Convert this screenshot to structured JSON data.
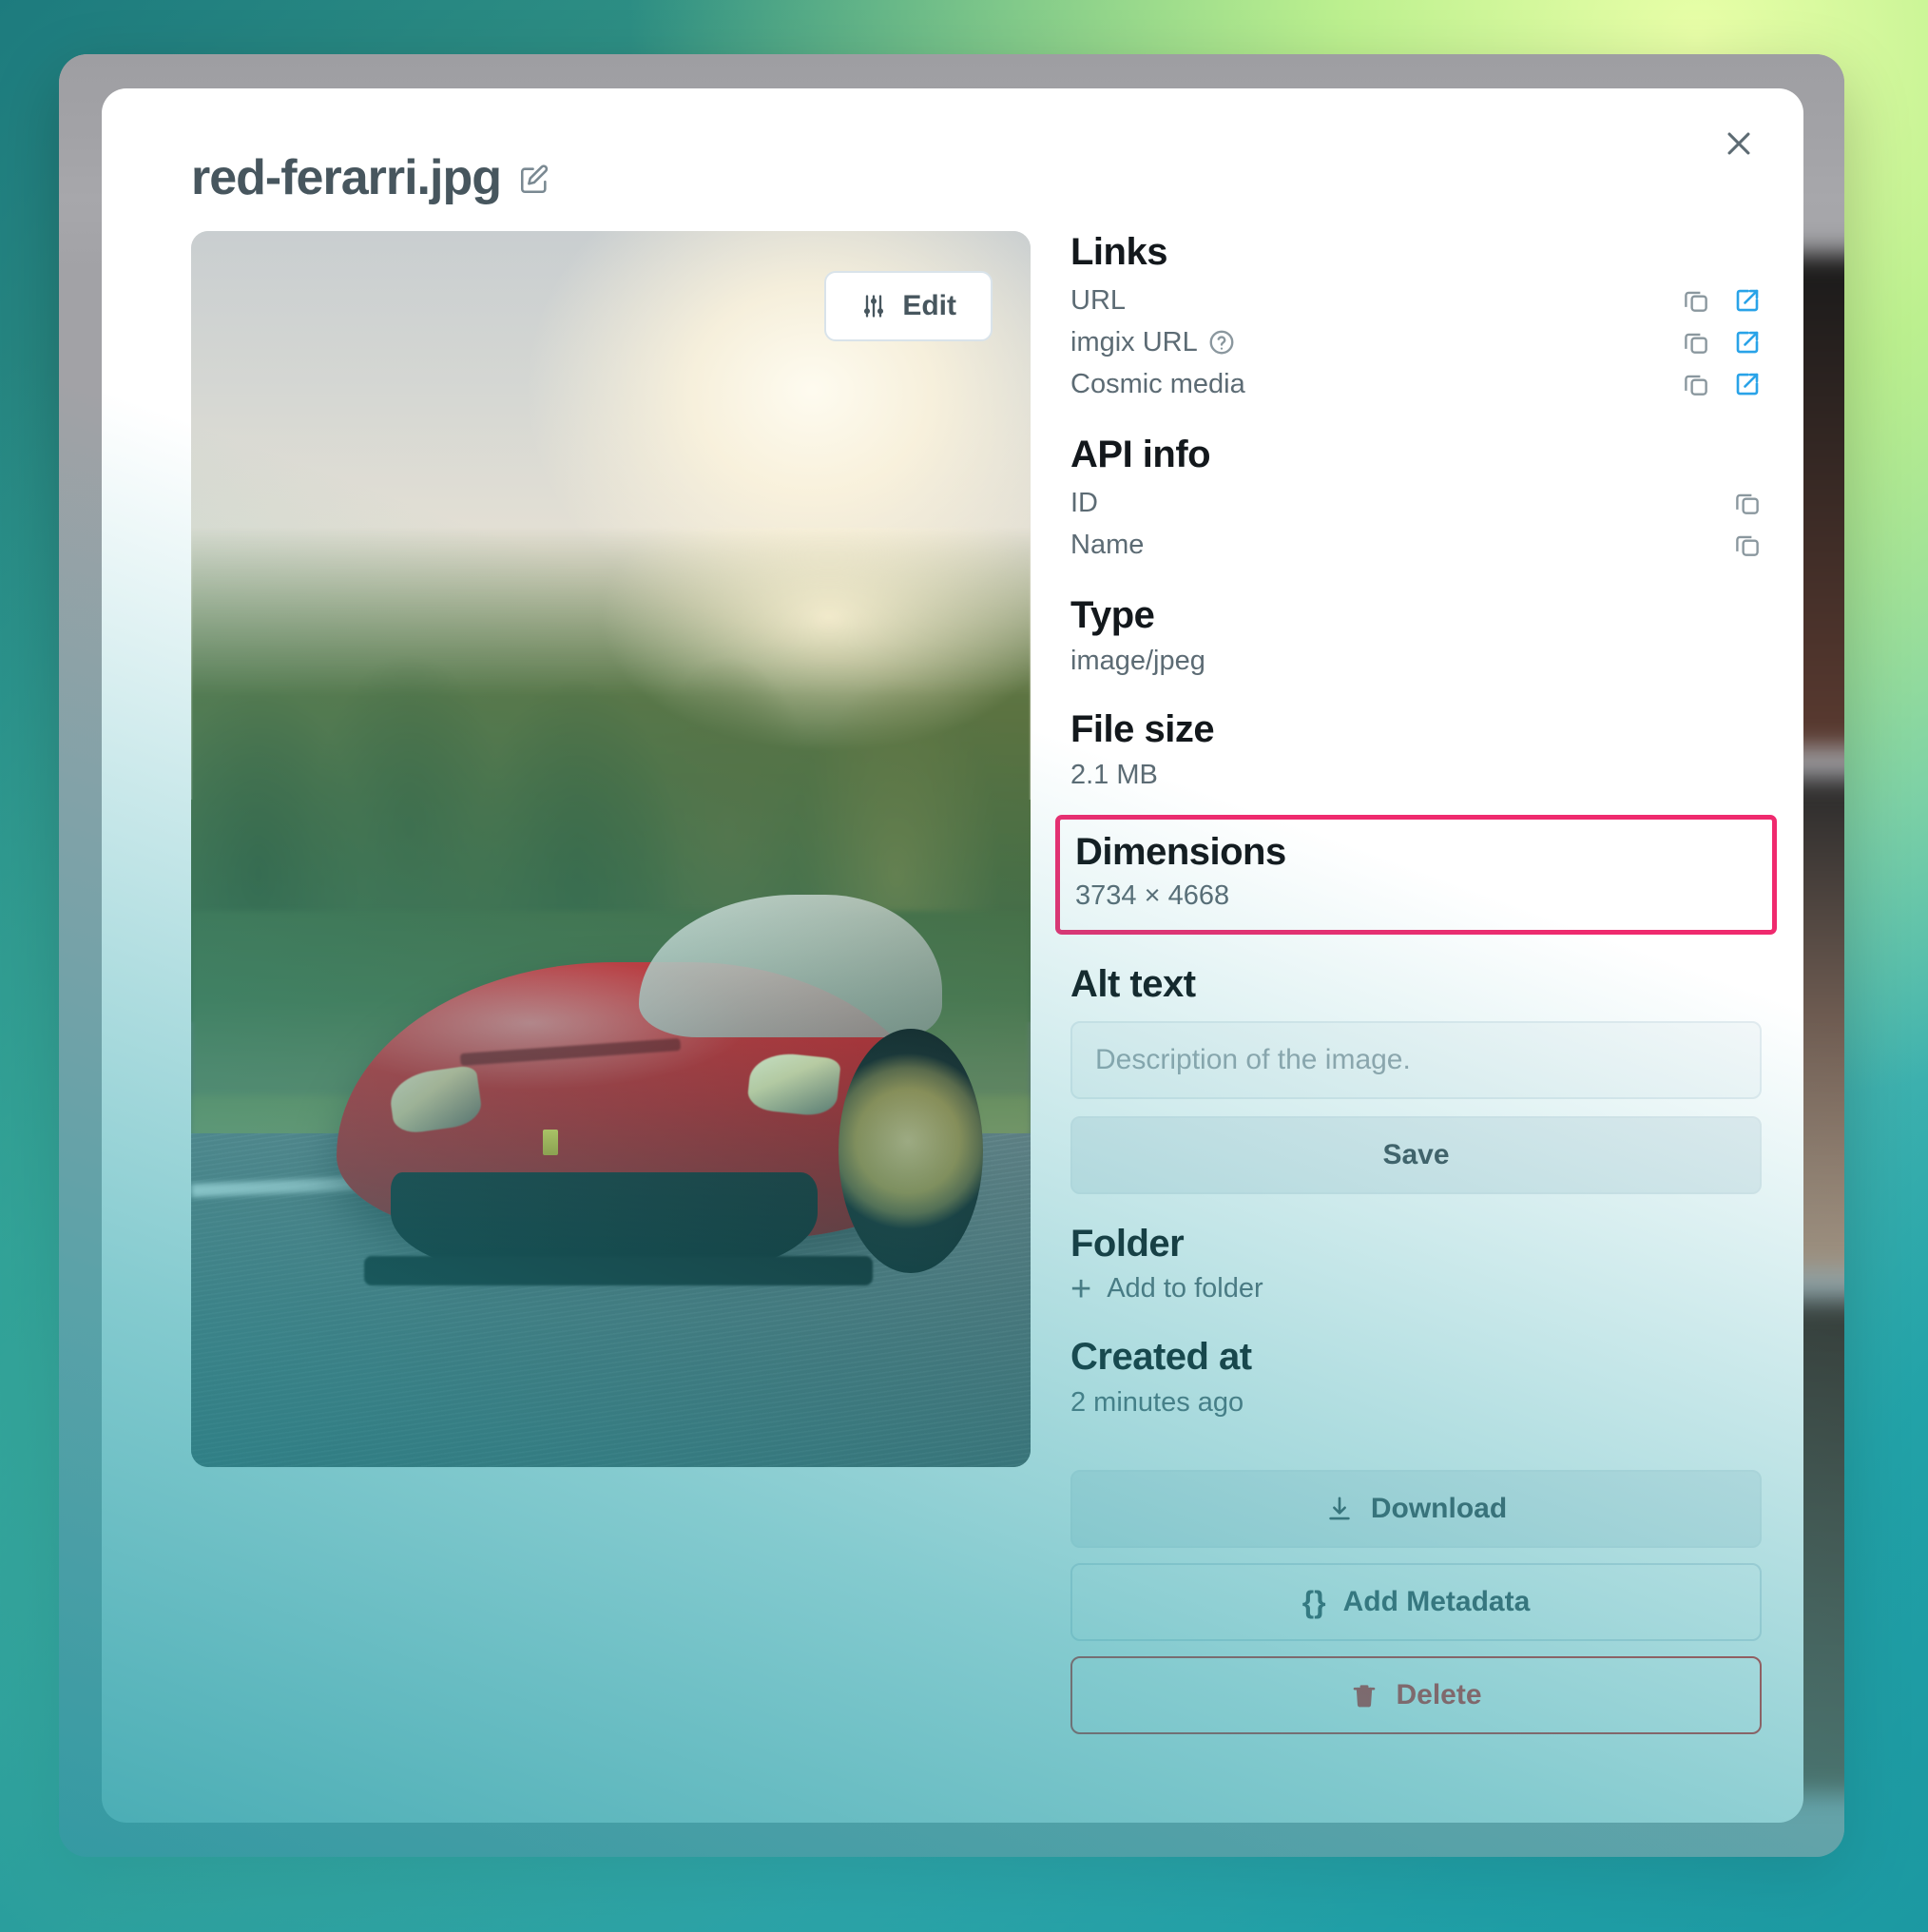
{
  "theme": {
    "accent_blue": "#29a3e8",
    "highlight_pink": "#ef2a6e",
    "danger_red": "#e03131",
    "text_dark": "#13181c",
    "text_muted": "#5c6b74",
    "title_color": "#47565e",
    "frame_gray": "#a4a4a6"
  },
  "modal": {
    "title": "red-ferarri.jpg",
    "title_edit_icon": "edit-pencil-square-icon",
    "close_icon": "close-x-icon"
  },
  "preview": {
    "edit_button_label": "Edit",
    "edit_button_icon": "sliders-icon",
    "image_alt": "Red Ferrari sports car driving on a road at sunset"
  },
  "sidebar": {
    "links": {
      "heading": "Links",
      "rows": [
        {
          "label": "URL",
          "copy_icon": "copy-icon",
          "open_icon": "external-link-icon",
          "has_help": false
        },
        {
          "label": "imgix URL",
          "copy_icon": "copy-icon",
          "open_icon": "external-link-icon",
          "has_help": true,
          "help_icon": "question-circle-icon"
        },
        {
          "label": "Cosmic media",
          "copy_icon": "copy-icon",
          "open_icon": "external-link-icon",
          "has_help": false
        }
      ]
    },
    "api_info": {
      "heading": "API info",
      "rows": [
        {
          "label": "ID",
          "copy_icon": "copy-icon"
        },
        {
          "label": "Name",
          "copy_icon": "copy-icon"
        }
      ]
    },
    "type": {
      "heading": "Type",
      "value": "image/jpeg"
    },
    "file_size": {
      "heading": "File size",
      "value": "2.1 MB"
    },
    "dimensions": {
      "heading": "Dimensions",
      "value": "3734 × 4668",
      "highlighted": true
    },
    "alt_text": {
      "heading": "Alt text",
      "value": "",
      "placeholder": "Description of the image.",
      "save_label": "Save"
    },
    "folder": {
      "heading": "Folder",
      "add_label": "Add to folder",
      "add_icon": "plus-icon"
    },
    "created_at": {
      "heading": "Created at",
      "value": "2 minutes ago"
    },
    "actions": [
      {
        "label": "Download",
        "icon": "download-icon",
        "style": "filled"
      },
      {
        "label": "Add Metadata",
        "icon": "curly-braces-icon",
        "style": "outline"
      },
      {
        "label": "Delete",
        "icon": "trash-icon",
        "style": "danger"
      }
    ]
  }
}
